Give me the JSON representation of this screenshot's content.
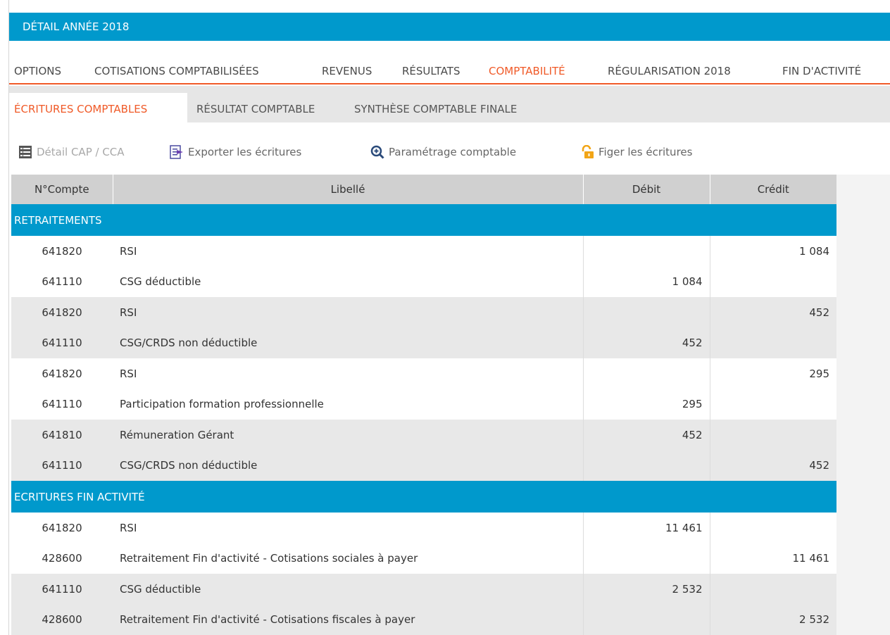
{
  "window": {
    "title": "DÉTAIL ANNÉE 2018"
  },
  "main_tabs": [
    {
      "label": "OPTIONS",
      "active": false
    },
    {
      "label": "COTISATIONS COMPTABILISÉES",
      "active": false
    },
    {
      "label": "REVENUS",
      "active": false
    },
    {
      "label": "RÉSULTATS",
      "active": false
    },
    {
      "label": "COMPTABILITÉ",
      "active": true
    },
    {
      "label": "RÉGULARISATION 2018",
      "active": false
    },
    {
      "label": "FIN D'ACTIVITÉ",
      "active": false
    }
  ],
  "sub_tabs": [
    {
      "label": "ÉCRITURES COMPTABLES",
      "active": true
    },
    {
      "label": "RÉSULTAT COMPTABLE",
      "active": false
    },
    {
      "label": "SYNTHÈSE COMPTABLE FINALE",
      "active": false
    }
  ],
  "toolbar": {
    "detail_label": "Détail CAP / CCA",
    "detail_icon": "list-icon",
    "export_label": "Exporter les écritures",
    "export_icon": "export-icon",
    "settings_label": "Paramétrage comptable",
    "settings_icon": "zoom-plus-icon",
    "freeze_label": "Figer les écritures",
    "freeze_icon": "unlock-icon"
  },
  "table": {
    "headers": [
      "N°Compte",
      "Libellé",
      "Débit",
      "Crédit"
    ],
    "groups": [
      {
        "title": "RETRAITEMENTS",
        "rows": [
          {
            "account": "641820",
            "label": "RSI",
            "debit": "",
            "credit": "1 084",
            "stripe": "a"
          },
          {
            "account": "641110",
            "label": "CSG déductible",
            "debit": "1 084",
            "credit": "",
            "stripe": "a"
          },
          {
            "account": "641820",
            "label": "RSI",
            "debit": "",
            "credit": "452",
            "stripe": "b"
          },
          {
            "account": "641110",
            "label": "CSG/CRDS non déductible",
            "debit": "452",
            "credit": "",
            "stripe": "b"
          },
          {
            "account": "641820",
            "label": "RSI",
            "debit": "",
            "credit": "295",
            "stripe": "a"
          },
          {
            "account": "641110",
            "label": "Participation formation professionnelle",
            "debit": "295",
            "credit": "",
            "stripe": "a"
          },
          {
            "account": "641810",
            "label": "Rémuneration Gérant",
            "debit": "452",
            "credit": "",
            "stripe": "b"
          },
          {
            "account": "641110",
            "label": "CSG/CRDS non déductible",
            "debit": "",
            "credit": "452",
            "stripe": "b"
          }
        ]
      },
      {
        "title": "ECRITURES FIN ACTIVITÉ",
        "rows": [
          {
            "account": "641820",
            "label": "RSI",
            "debit": "11 461",
            "credit": "",
            "stripe": "a"
          },
          {
            "account": "428600",
            "label": "Retraitement Fin d'activité - Cotisations sociales à payer",
            "debit": "",
            "credit": "11 461",
            "stripe": "a"
          },
          {
            "account": "641110",
            "label": "CSG déductible",
            "debit": "2 532",
            "credit": "",
            "stripe": "b"
          },
          {
            "account": "428600",
            "label": "Retraitement Fin d'activité - Cotisations fiscales à payer",
            "debit": "",
            "credit": "2 532",
            "stripe": "b"
          }
        ]
      }
    ]
  },
  "colors": {
    "accent_blue": "#0099cc",
    "active_orange": "#f05a28",
    "header_gray": "#d0d0d0"
  }
}
